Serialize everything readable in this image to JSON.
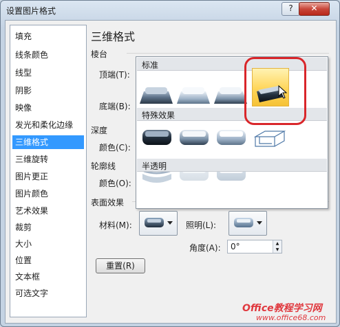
{
  "window": {
    "title": "设置图片格式",
    "help": "?",
    "close": "✕"
  },
  "nav": {
    "items": [
      {
        "label": "填充"
      },
      {
        "label": "线条颜色"
      },
      {
        "label": "线型"
      },
      {
        "label": "阴影"
      },
      {
        "label": "映像"
      },
      {
        "label": "发光和柔化边缘"
      },
      {
        "label": "三维格式",
        "selected": true
      },
      {
        "label": "三维旋转"
      },
      {
        "label": "图片更正"
      },
      {
        "label": "图片颜色"
      },
      {
        "label": "艺术效果"
      },
      {
        "label": "裁剪"
      },
      {
        "label": "大小"
      },
      {
        "label": "位置"
      },
      {
        "label": "文本框"
      },
      {
        "label": "可选文字"
      }
    ]
  },
  "panel": {
    "heading": "三维格式",
    "bevel_section": "棱台",
    "top_label": "顶端(T):",
    "bottom_label": "底端(B):",
    "depth_section": "深度",
    "depth_color_label": "颜色(C):",
    "contour_section": "轮廓线",
    "contour_color_label": "颜色(O):",
    "surface_section": "表面效果",
    "material_label": "材料(M):",
    "lighting_label": "照明(L):",
    "angle_label": "角度(A):",
    "angle_value": "0°",
    "reset_button": "重置(R)"
  },
  "material_popup": {
    "groups": [
      {
        "header": "标准",
        "count": 4,
        "selected_index": 3
      },
      {
        "header": "特殊效果",
        "count": 4
      },
      {
        "header": "半透明",
        "count": 3
      }
    ]
  },
  "watermark": {
    "line1": "Office教程学习网",
    "line2": "www.office68.com"
  },
  "colors": {
    "selection": "#3399ff",
    "highlight": "#ffd559",
    "annotation_ring": "#d9262a"
  }
}
